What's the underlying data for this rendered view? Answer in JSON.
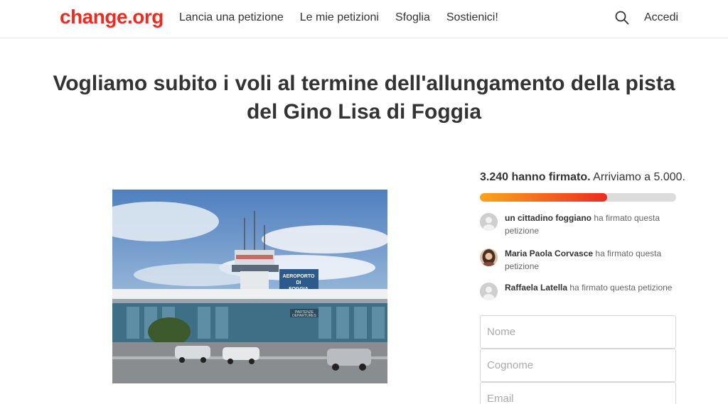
{
  "header": {
    "logo": "change.org",
    "nav": [
      "Lancia una petizione",
      "Le mie petizioni",
      "Sfoglia",
      "Sostienici!"
    ],
    "login": "Accedi"
  },
  "petition": {
    "title": "Vogliamo subito i voli al termine dell'allungamento della pista del Gino Lisa di Foggia",
    "photo_sign_top": "AEROPORTO",
    "photo_sign_mid": "DI",
    "photo_sign_bottom": "FOGGIA",
    "photo_sign_door_1": "PARTENZE",
    "photo_sign_door_2": "DEPARTURES"
  },
  "progress": {
    "signed": "3.240 hanno firmato.",
    "goal": " Arriviamo a 5.000.",
    "fraction": 0.648,
    "colors": {
      "start": "#f9a51a",
      "end": "#ec2c22",
      "track": "#dcdcdc"
    }
  },
  "signers": [
    {
      "name": "un cittadino foggiano",
      "action": " ha firmato questa petizione"
    },
    {
      "name": "Maria Paola Corvasce",
      "action": " ha firmato questa petizione"
    },
    {
      "name": "Raffaela Latella",
      "action": " ha firmato questa petizione"
    }
  ],
  "form": {
    "first_name_placeholder": "Nome",
    "last_name_placeholder": "Cognome",
    "email_placeholder": "Email"
  },
  "colors": {
    "brand": "#ec2c22"
  }
}
